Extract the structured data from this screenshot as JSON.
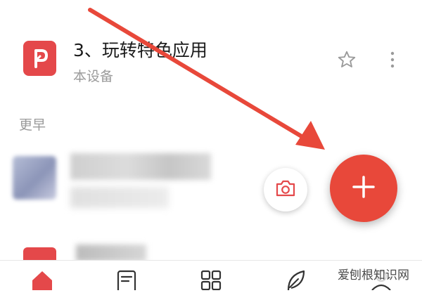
{
  "recent_files": [
    {
      "title": "3、玩转特色应用",
      "location": "本设备",
      "icon": "ppt-file-icon",
      "icon_color": "#e4484a"
    }
  ],
  "section": {
    "label": "更早"
  },
  "actions": {
    "camera_icon": "camera-icon",
    "fab_icon": "plus-icon",
    "fab_color": "#e8483a"
  },
  "bottom_nav": {
    "items": [
      {
        "icon": "home-icon",
        "active": true
      },
      {
        "icon": "document-icon"
      },
      {
        "icon": "apps-grid-icon"
      },
      {
        "icon": "leaf-icon"
      },
      {
        "icon": "person-icon"
      }
    ]
  },
  "annotation": {
    "arrow_color": "#e8483a"
  },
  "watermark": {
    "text": "爱刨根知识网"
  }
}
